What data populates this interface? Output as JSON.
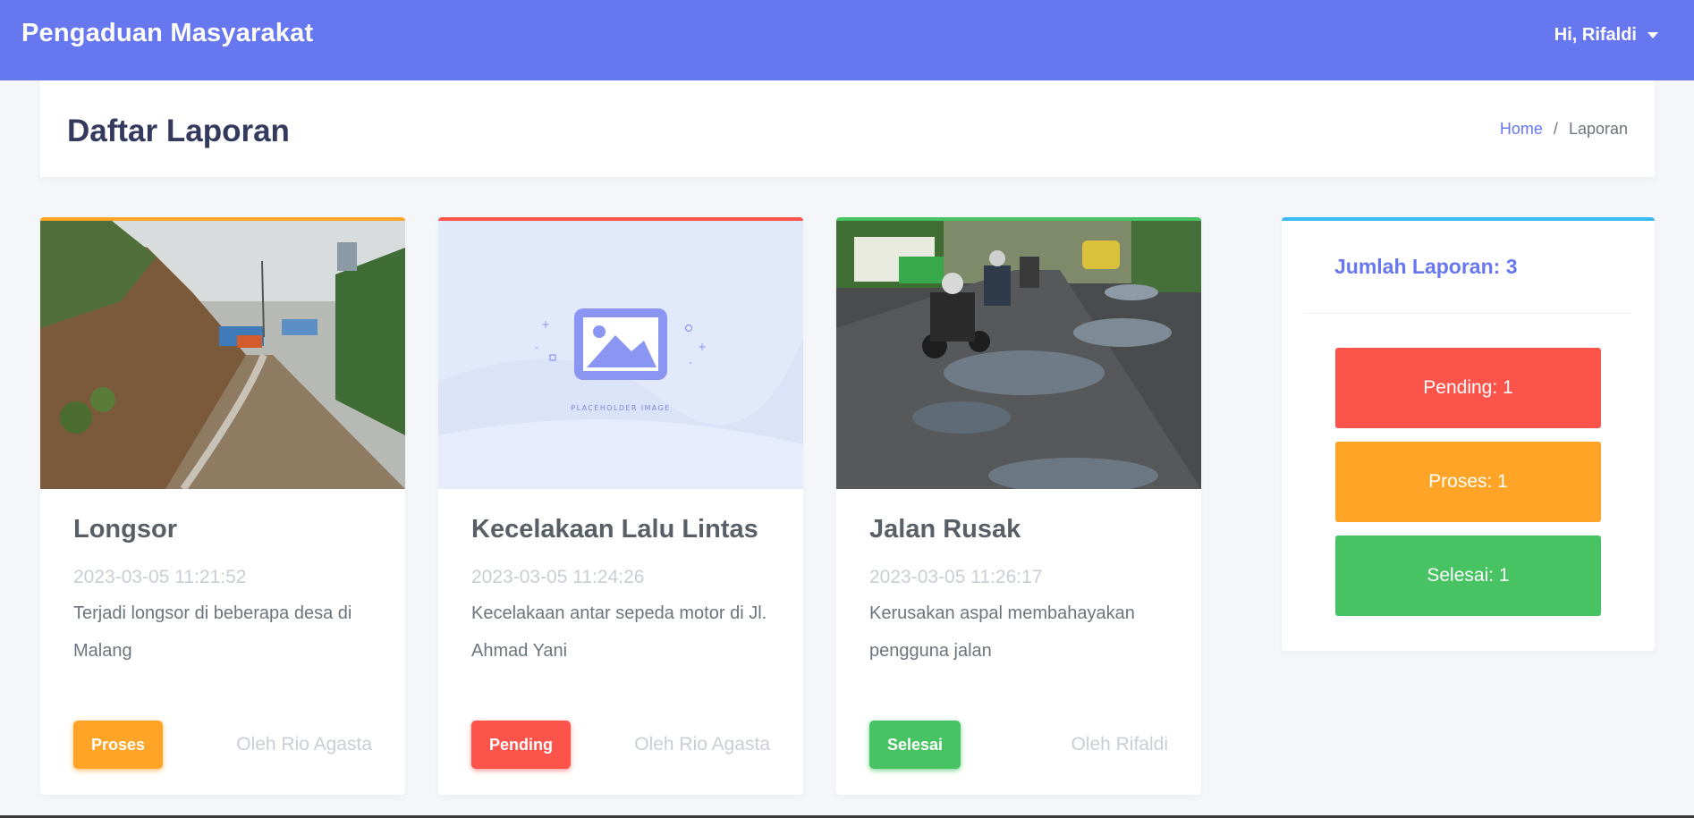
{
  "navbar": {
    "brand": "Pengaduan Masyarakat",
    "user": "Hi, Rifaldi",
    "accent": "#6777ef"
  },
  "header": {
    "title": "Daftar Laporan",
    "breadcrumb": {
      "home": "Home",
      "current": "Laporan"
    }
  },
  "reports": [
    {
      "title": "Longsor",
      "date": "2023-03-05 11:21:52",
      "description": "Terjadi longsor di beberapa desa di Malang",
      "status": "Proses",
      "author": "Oleh Rio Agasta",
      "status_color": "#ffa426"
    },
    {
      "title": "Kecelakaan Lalu Lintas",
      "date": "2023-03-05 11:24:26",
      "description": "Kecelakaan antar sepeda motor di Jl. Ahmad Yani",
      "status": "Pending",
      "author": "Oleh Rio Agasta",
      "status_color": "#fc544b",
      "image_label": "PLACEHOLDER IMAGE"
    },
    {
      "title": "Jalan Rusak",
      "date": "2023-03-05 11:26:17",
      "description": "Kerusakan aspal membahayakan pengguna jalan",
      "status": "Selesai",
      "author": "Oleh Rifaldi",
      "status_color": "#47c363"
    }
  ],
  "stats": {
    "title": "Jumlah Laporan: 3",
    "pending": "Pending: 1",
    "proses": "Proses: 1",
    "selesai": "Selesai: 1",
    "accent": "#3abaf4"
  }
}
